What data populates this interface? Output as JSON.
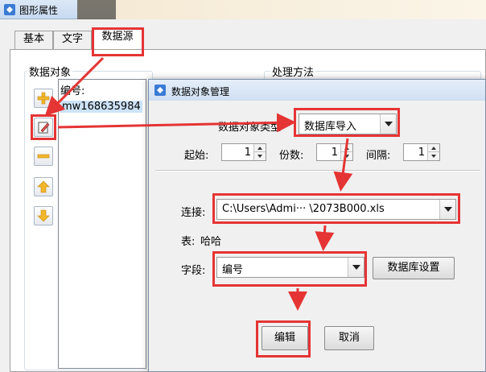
{
  "window": {
    "title": "图形属性"
  },
  "tabs": [
    {
      "label": "基本"
    },
    {
      "label": "文字"
    },
    {
      "label": "数据源"
    }
  ],
  "left_panel": {
    "group_label": "数据对象",
    "list_items": [
      {
        "label": "编号:"
      },
      {
        "label": "mw168635984"
      }
    ],
    "side_buttons": [
      "add-icon",
      "edit-icon",
      "remove-icon",
      "move-up-icon",
      "move-down-icon"
    ]
  },
  "right_panel": {
    "group_label": "处理方法"
  },
  "dialog": {
    "title": "数据对象管理",
    "type_label": "数据对象类型",
    "type_value": "数据库导入",
    "start_label": "起始:",
    "start_value": "1",
    "copies_label": "份数:",
    "copies_value": "1",
    "interval_label": "间隔:",
    "interval_value": "1",
    "connection_label": "连接:",
    "connection_value": "C:\\Users\\Admi··· \\2073B000.xls",
    "table_label": "表:",
    "table_value": "哈哈",
    "field_label": "字段:",
    "field_value": "编号",
    "db_settings_button": "数据库设置",
    "edit_button": "编辑",
    "cancel_button": "取消"
  },
  "colors": {
    "annotation_red": "#e53434",
    "selection_blue": "#cde3f7"
  }
}
